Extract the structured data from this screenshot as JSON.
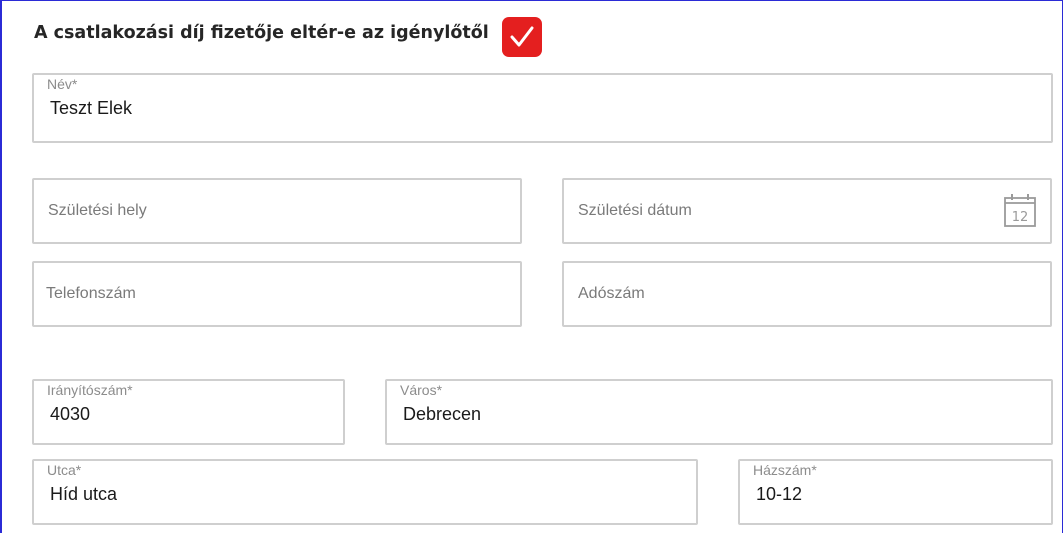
{
  "payer_section": {
    "question": "A csatlakozási díj fizetője eltér-e az igénylőtől",
    "checkbox_checked": true,
    "checkbox_color": "#e41f1f"
  },
  "fields": {
    "name": {
      "label": "Név*",
      "value": "Teszt Elek"
    },
    "birth_place": {
      "placeholder": "Születési hely"
    },
    "birth_date": {
      "placeholder": "Születési dátum",
      "icon": "calendar-icon",
      "icon_text": "12"
    },
    "phone": {
      "placeholder": "Telefonszám"
    },
    "tax_number": {
      "placeholder": "Adószám"
    },
    "postal_code": {
      "label": "Irányítószám*",
      "value": "4030"
    },
    "city": {
      "label": "Város*",
      "value": "Debrecen"
    },
    "street": {
      "label": "Utca*",
      "value": "Híd utca"
    },
    "house_number": {
      "label": "Házszám*",
      "value": "10-12"
    }
  },
  "colors": {
    "accent": "#e41f1f",
    "border": "#cfcfcf",
    "frame": "#2b2bd6"
  }
}
